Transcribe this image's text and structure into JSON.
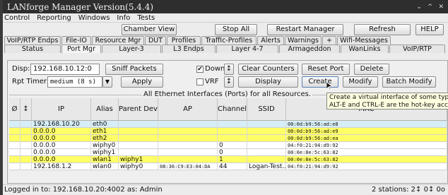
{
  "window": {
    "title": "LANforge Manager   Version(5.4.4)",
    "controls": [
      "⌄",
      "^",
      "✕"
    ]
  },
  "menu": [
    "Control",
    "Reporting",
    "Windows",
    "Info",
    "Tests"
  ],
  "toolbar": {
    "chamber_view": "Chamber View",
    "stop_all": "Stop All",
    "restart_manager": "Restart Manager",
    "refresh": "Refresh",
    "help": "HELP"
  },
  "tabs_row1": [
    "VoIP/RTP Endps",
    "File-IO",
    "Resource Mgr",
    "DUT",
    "Profiles",
    "Traffic-Profiles",
    "Alerts",
    "Warnings",
    "+",
    "Wifi-Messages"
  ],
  "tabs_row2": [
    "Status",
    "Port Mgr",
    "Layer-3",
    "L3 Endps",
    "Layer 4-7",
    "Armageddon",
    "WanLinks",
    "VoIP/RTP"
  ],
  "controls": {
    "disp_label": "Disp:",
    "disp_value": "192.168.10.12:0",
    "sniff_packets": "Sniff Packets",
    "down_label": "Down",
    "vrf_label": "VRF",
    "clear_counters": "Clear Counters",
    "reset_port": "Reset Port",
    "delete": "Delete",
    "rpt_timer_label": "Rpt Timer:",
    "rpt_timer_value": "medium  (8 s)",
    "apply": "Apply",
    "display": "Display",
    "create": "Create",
    "modify": "Modify",
    "batch_modify": "Batch Modify",
    "spinner_glyph": "↕"
  },
  "group_title": "All Ethernet Interfaces (Ports) for all Resources.",
  "table": {
    "headers": [
      "Ø",
      "↕",
      "IP",
      "Alias",
      "Parent Dev",
      "AP",
      "Channel",
      "SSID",
      "MAC"
    ],
    "rows": [
      {
        "ip": "192.168.10.20",
        "alias": "eth0",
        "parent": "",
        "ap": "",
        "channel": "",
        "ssid": "",
        "mac": "00:0d:b9:56:ad:e8",
        "color": "#d6eef7"
      },
      {
        "ip": "0.0.0.0",
        "alias": "eth1",
        "parent": "",
        "ap": "",
        "channel": "",
        "ssid": "",
        "mac": "00:0d:b9:56:ad:e9",
        "color": "#ffff66"
      },
      {
        "ip": "0.0.0.0",
        "alias": "eth2",
        "parent": "",
        "ap": "",
        "channel": "",
        "ssid": "",
        "mac": "00:0d:b9:56:ad:ea",
        "color": "#ffff66"
      },
      {
        "ip": "0.0.0.0",
        "alias": "wiphy0",
        "parent": "",
        "ap": "",
        "channel": "0",
        "ssid": "",
        "mac": "04:f0:21:94:d9:92",
        "color": "#ffffff"
      },
      {
        "ip": "0.0.0.0",
        "alias": "wiphy1",
        "parent": "",
        "ap": "",
        "channel": "0",
        "ssid": "",
        "mac": "00:0e:8e:5c:63:82",
        "color": "#ffffff"
      },
      {
        "ip": "0.0.0.0",
        "alias": "wlan1",
        "parent": "wiphy1",
        "ap": "",
        "channel": "1",
        "ssid": "",
        "mac": "00:0e:8e:5c:63:82",
        "color": "#ffff66"
      },
      {
        "ip": "192.168.1.2",
        "alias": "wlan0",
        "parent": "wiphy0",
        "ap": "08:36:C9:E3:04:DA",
        "channel": "44",
        "ssid": "Logan-Test...",
        "mac": "04:f0:21:94:d9:92",
        "color": "#ffffff"
      }
    ]
  },
  "tooltip": {
    "line1": "Create a virtual interface of some type.",
    "line2": "ALT-E and CTRL-E are the hot-key accele"
  },
  "status": {
    "left": "Logged in to:  192.168.10.20:4002  as:  Admin",
    "right": "2 stations: 2↕ 0↕ 0o"
  }
}
